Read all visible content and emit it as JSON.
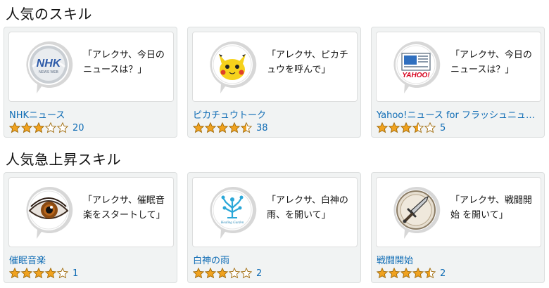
{
  "sections": [
    {
      "title": "人気のスキル",
      "items": [
        {
          "name": "NHKニュース",
          "quote": "「アレクサ、今日の\nニュースは？」",
          "rating": 3,
          "count": "20",
          "icon": "nhk-news-icon"
        },
        {
          "name": "ピカチュウトーク",
          "quote": "「アレクサ、ピカチ\nュウを呼んで」",
          "rating": 4.5,
          "count": "38",
          "icon": "pikachu-icon"
        },
        {
          "name": "Yahoo!ニュース for フラッシュニュース",
          "quote": "「アレクサ、今日の\nニュースは？」",
          "rating": 3.5,
          "count": "5",
          "icon": "yahoo-news-icon"
        }
      ]
    },
    {
      "title": "人気急上昇スキル",
      "items": [
        {
          "name": "催眠音楽",
          "quote": "「アレクサ、催眠音\n楽をスタートして」",
          "rating": 4,
          "count": "1",
          "icon": "eye-icon"
        },
        {
          "name": "白神の雨",
          "quote": "「アレクサ、白神の\n雨、を開いて」",
          "rating": 3,
          "count": "2",
          "icon": "healing-garden-tree-icon"
        },
        {
          "name": "戦闘開始",
          "quote": "「アレクサ、戦闘開\n始 を開いて」",
          "rating": 4.5,
          "count": "2",
          "icon": "sword-icon"
        }
      ]
    }
  ],
  "icon_text": {
    "nhk_logo": "NHK",
    "nhk_sub": "NEWS WEB",
    "yahoo_logo": "YAHOO!",
    "healing_label": "Healing Garden"
  },
  "colors": {
    "link": "#0f6cb5",
    "star": "#f0a21f",
    "star_stroke": "#a06a0a"
  }
}
